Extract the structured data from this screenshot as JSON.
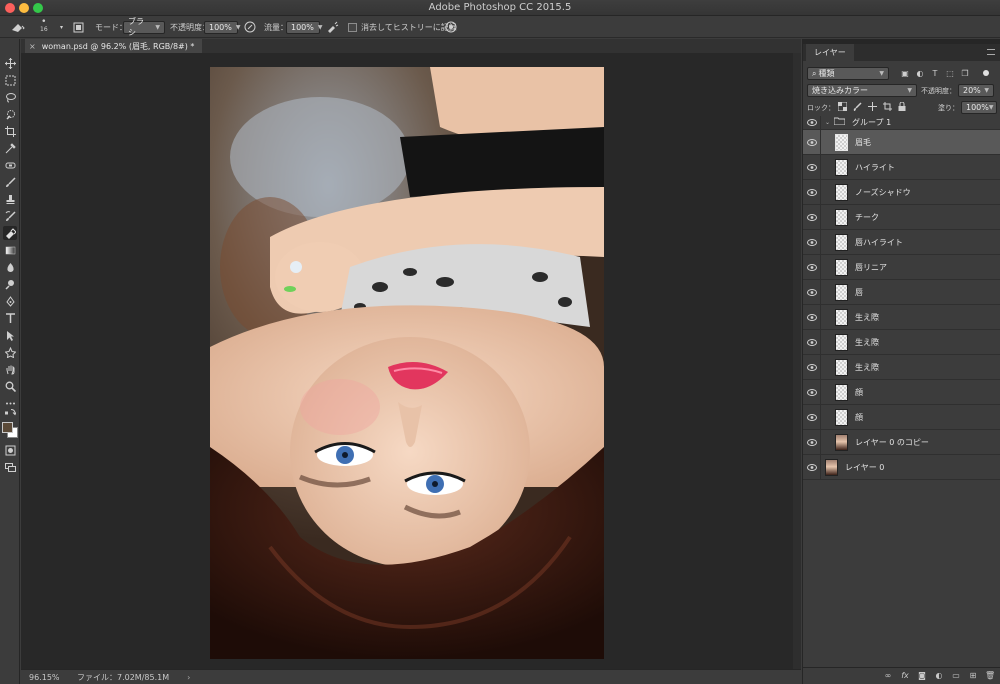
{
  "app": {
    "title": "Adobe Photoshop CC 2015.5"
  },
  "options": {
    "brush_size": "16",
    "mode_label": "モード：",
    "mode_value": "ブラシ",
    "opacity_label": "不透明度：",
    "opacity_value": "100%",
    "flow_label": "流量：",
    "flow_value": "100%",
    "history_label": "消去してヒストリーに記録"
  },
  "document": {
    "tab_label": "woman.psd @ 96.2% (眉毛, RGB/8#) *"
  },
  "status": {
    "zoom": "96.15%",
    "file_info": "ファイル：7.02M/85.1M"
  },
  "layers_panel": {
    "tab_label": "レイヤー",
    "filter_kind": "種類",
    "blend_mode": "焼き込みカラー",
    "opacity_label": "不透明度：",
    "opacity_value": "20%",
    "lock_label": "ロック：",
    "fill_label": "塗り：",
    "fill_value": "100%",
    "group_name": "グループ 1",
    "layers": [
      {
        "name": "眉毛",
        "selected": true
      },
      {
        "name": "ハイライト"
      },
      {
        "name": "ノーズシャドウ"
      },
      {
        "name": "チーク"
      },
      {
        "name": "唇ハイライト"
      },
      {
        "name": "唇リニア"
      },
      {
        "name": "唇"
      },
      {
        "name": "生え際"
      },
      {
        "name": "生え際"
      },
      {
        "name": "生え際"
      },
      {
        "name": "顔"
      },
      {
        "name": "顔"
      },
      {
        "name": "レイヤー 0 のコピー"
      },
      {
        "name": "レイヤー 0"
      }
    ]
  },
  "colors": {
    "foreground": "#5b4a38",
    "background": "#ffffff",
    "selected_layer": "#595959"
  }
}
